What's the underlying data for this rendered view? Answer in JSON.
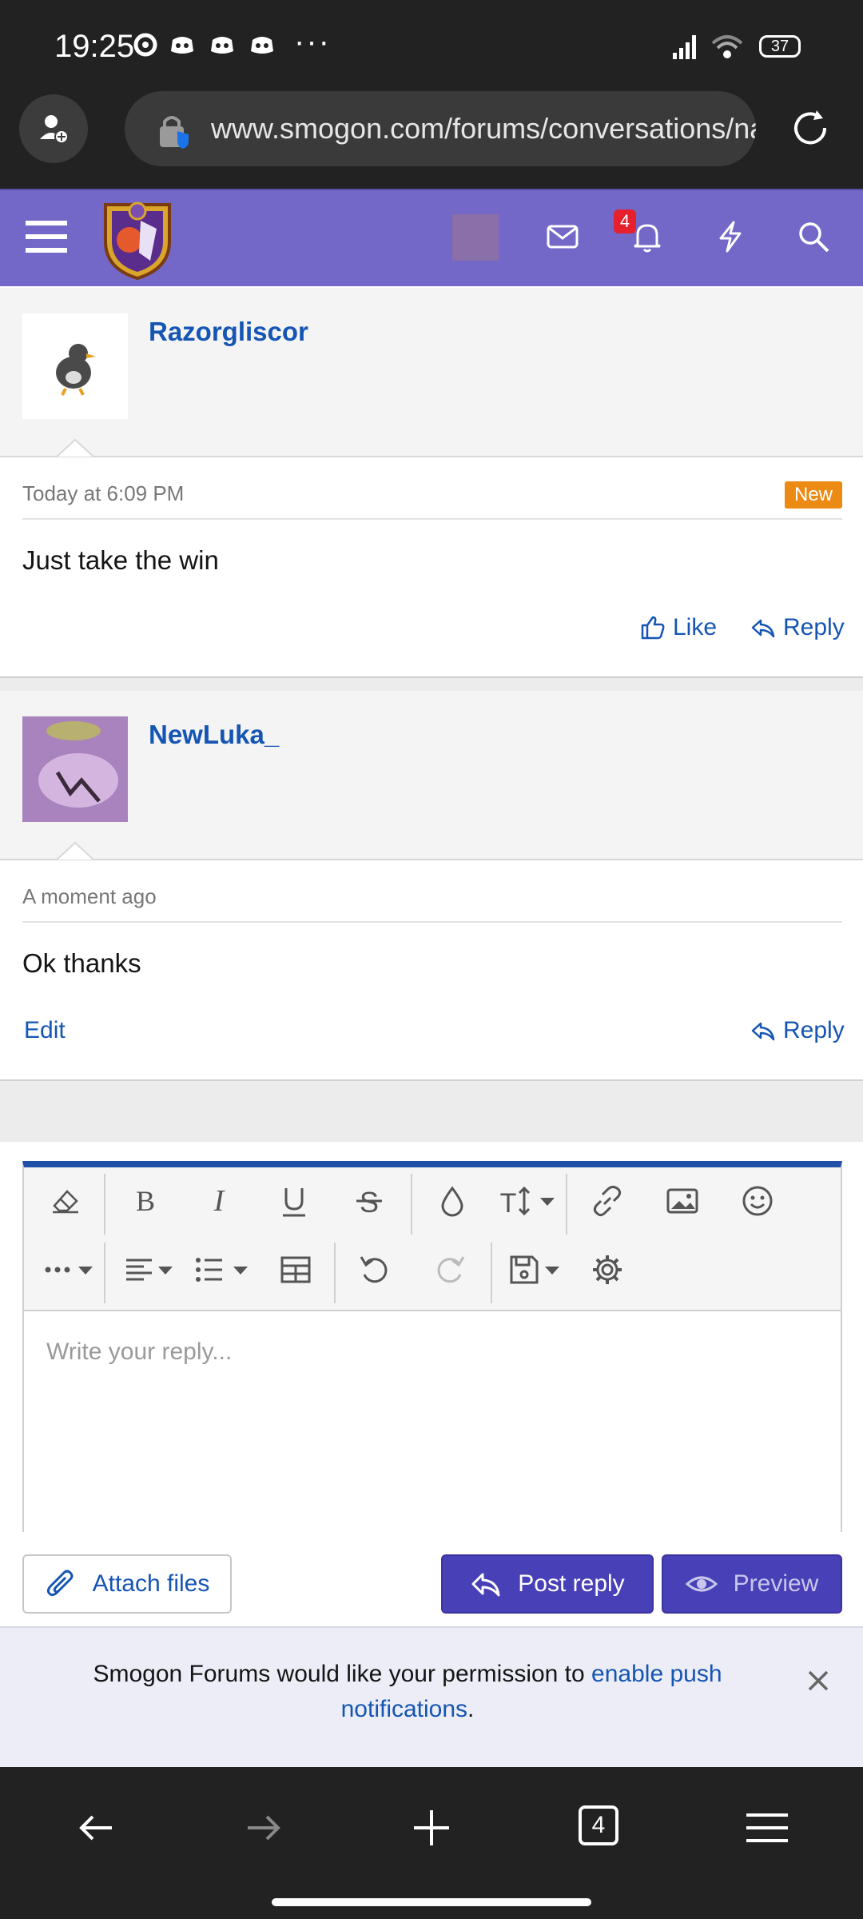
{
  "status_bar": {
    "time": "19:25",
    "more": "···",
    "battery": "37"
  },
  "browser": {
    "url": "www.smogon.com/forums/conversations/na"
  },
  "header": {
    "notification_count": "4"
  },
  "messages": [
    {
      "username": "Razorgliscor",
      "time": "Today at 6:09 PM",
      "badge": "New",
      "text": "Just take the win",
      "like_label": "Like",
      "reply_label": "Reply"
    },
    {
      "username": "NewLuka_",
      "time": "A moment ago",
      "text": "Ok thanks",
      "edit_label": "Edit",
      "reply_label": "Reply"
    }
  ],
  "editor": {
    "placeholder": "Write your reply..."
  },
  "buttons": {
    "attach": "Attach files",
    "post": "Post reply",
    "preview": "Preview"
  },
  "notice": {
    "text_before": "Smogon Forums would like your permission to ",
    "link": "enable push notifications",
    "text_after": "."
  },
  "bottom_nav": {
    "tab_count": "4"
  },
  "colors": {
    "header_purple": "#7367c8",
    "link_blue": "#1555b3",
    "button_purple": "#4840b6",
    "new_badge": "#eb8b14",
    "notification_red": "#e5212e"
  }
}
